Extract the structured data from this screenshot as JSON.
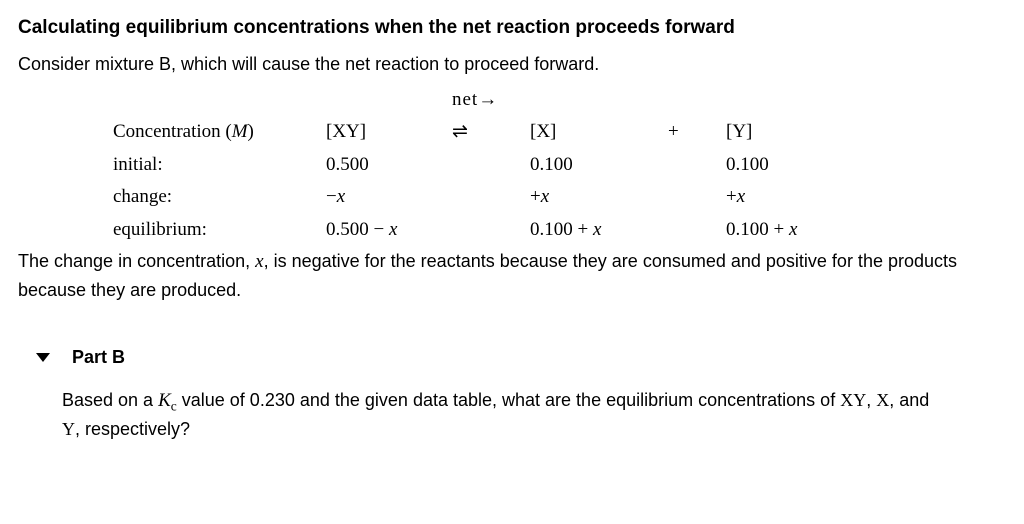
{
  "heading": "Calculating equilibrium concentrations when the net reaction proceeds forward",
  "intro": "Consider mixture B, which will cause the net reaction to proceed forward.",
  "net_label": "net",
  "net_arrow": "→",
  "table": {
    "header": {
      "label": "Concentration (M)",
      "xy": "[XY]",
      "eq": "⇌",
      "x": "[X]",
      "plus": "+",
      "y": "[Y]"
    },
    "initial": {
      "label": "initial:",
      "xy": "0.500",
      "x": "0.100",
      "y": "0.100"
    },
    "change": {
      "label": "change:",
      "xy": "−x",
      "x": "+x",
      "y": "+x"
    },
    "equilibrium": {
      "label": "equilibrium:",
      "xy": "0.500 − x",
      "x": "0.100 + x",
      "y": "0.100 + x"
    }
  },
  "explain_pre": "The change in concentration, ",
  "explain_var": "x",
  "explain_post": ", is negative for the reactants because they are consumed and positive for the products because they are produced.",
  "partb_label": "Part B",
  "q_pre": "Based on a ",
  "q_kc_k": "K",
  "q_kc_sub": "c",
  "q_mid": " value of 0.230 and the given data table, what are the equilibrium concentrations of ",
  "q_xy": "XY",
  "q_comma1": ", ",
  "q_x": "X",
  "q_comma2": ", and ",
  "q_y": "Y",
  "q_end": ", respectively?"
}
